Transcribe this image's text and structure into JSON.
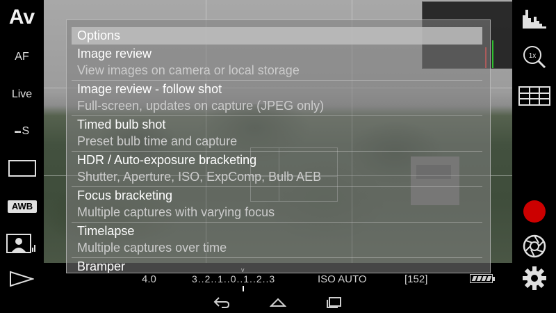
{
  "left_bar": {
    "mode": "Av",
    "af": "AF",
    "live": "Live",
    "drive": "S",
    "white_balance": "AWB",
    "icons": [
      "aspect-ratio-icon",
      "face-detect-icon",
      "play-icon",
      "drive-mode-icon"
    ]
  },
  "right_bar": {
    "icons": [
      "histogram-icon",
      "zoom-1x-icon",
      "grid-icon",
      "record-icon",
      "shutter-icon",
      "settings-icon"
    ],
    "zoom_label": "1x",
    "record_color": "#cc0000"
  },
  "status": {
    "aperture": "4.0",
    "exposure_scale": "3..2..1..0..1..2..3",
    "exposure_marker": "v",
    "iso": "ISO AUTO",
    "remaining": "[152]",
    "battery_level": 1.0
  },
  "options": {
    "header": "Options",
    "items": [
      {
        "title": "Image review",
        "subtitle": "View images on camera or local storage"
      },
      {
        "title": "Image review - follow shot",
        "subtitle": "Full-screen, updates on capture (JPEG only)"
      },
      {
        "title": "Timed bulb shot",
        "subtitle": "Preset bulb time and capture"
      },
      {
        "title": "HDR / Auto-exposure bracketing",
        "subtitle": "Shutter, Aperture, ISO, ExpComp, Bulb AEB"
      },
      {
        "title": "Focus bracketing",
        "subtitle": "Multiple captures with varying focus"
      },
      {
        "title": "Timelapse",
        "subtitle": "Multiple captures over time"
      },
      {
        "title": "Bramper",
        "subtitle": ""
      }
    ]
  },
  "nav": {
    "icons": [
      "back-icon",
      "home-icon",
      "recents-icon"
    ]
  },
  "colors": {
    "panel_bg": "#808080",
    "header_bg": "#bebebe",
    "text": "#ffffff",
    "subtext": "#cccccc"
  }
}
